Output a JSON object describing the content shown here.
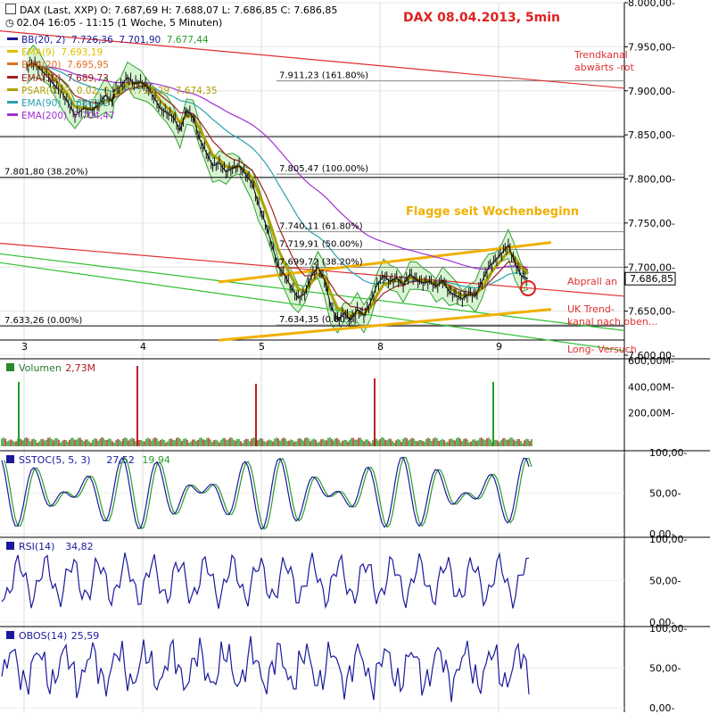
{
  "header": {
    "instrument": "DAX (Last, XXP)",
    "open": "O: 7.687,69",
    "high": "H: 7.688,07",
    "low": "L: 7.686,85",
    "close": "C: 7.686,85",
    "period": "02.04 16:05 - 11:15 (1 Woche, 5 Minuten)",
    "title": "DAX  08.04.2013,  5min"
  },
  "legend": [
    {
      "label": "BB(20, 2)",
      "values": [
        "7.726,36",
        "7.701,90",
        "7.677,44"
      ],
      "color": "#1a1a9c"
    },
    {
      "label": "EMA(9)",
      "values": [
        "7.693,19"
      ],
      "color": "#e0c000"
    },
    {
      "label": "EMA(20)",
      "values": [
        "7.695,95"
      ],
      "color": "#e07020"
    },
    {
      "label": "EMA(50)",
      "values": [
        "7.689,73"
      ],
      "color": "#a02020"
    },
    {
      "label": "PSAR(0.02, 0.02, 0.2)",
      "values": [
        "7.713,29",
        "7.674,35"
      ],
      "color": "#b0a000"
    },
    {
      "label": "EMA(90)",
      "values": [
        "7.686,62"
      ],
      "color": "#2aa0b0"
    },
    {
      "label": "EMA(200)",
      "values": [
        "7.704,47"
      ],
      "color": "#a030d0"
    }
  ],
  "annotations": {
    "trend_down": [
      "Trendkanal",
      "abwärts -rot"
    ],
    "flag": "Flagge seit Wochenbeginn",
    "bounce": "Abprall an",
    "uk_trend": [
      "UK Trend-",
      "kanal nach oben..."
    ],
    "long": "Long- Versuch"
  },
  "fib_labels": [
    {
      "text": "7.911,23 (161.80%)",
      "value": 7911.23
    },
    {
      "text": "7.801,80 (38.20%)",
      "value": 7801.8
    },
    {
      "text": "7.805,47 (100.00%)",
      "value": 7805.47
    },
    {
      "text": "7.740,11 (61.80%)",
      "value": 7740.11
    },
    {
      "text": "7.719,91 (50.00%)",
      "value": 7719.91
    },
    {
      "text": "7.699,72 (38.20%)",
      "value": 7699.72
    },
    {
      "text": "7.633,26 (0.00%)",
      "value": 7633.26
    },
    {
      "text": "7.634,35 (0.00%)",
      "value": 7634.35
    }
  ],
  "last_price_label": "7.686,85",
  "panels": {
    "volume": {
      "name": "Volumen",
      "value": "2,73M"
    },
    "sstoc": {
      "name": "SSTOC(5, 5, 3)",
      "value1": "27,52",
      "value2": "19,94"
    },
    "rsi": {
      "name": "RSI(14)",
      "value": "34,82"
    },
    "obos": {
      "name": "OBOS(14)",
      "value": "25,59"
    }
  },
  "chart_data": [
    {
      "type": "candlestick",
      "title": "DAX  08.04.2013,  5min",
      "x_ticks": [
        "3",
        "4",
        "5",
        "8",
        "9"
      ],
      "y_ticks": [
        "8.000,00",
        "7.950,00",
        "7.900,00",
        "7.850,00",
        "7.800,00",
        "7.750,00",
        "7.700,00",
        "7.650,00",
        "7.600,00"
      ],
      "ylim": [
        7600,
        8000
      ],
      "grid": true,
      "price_path": [
        [
          0,
          7928
        ],
        [
          0.3,
          7932
        ],
        [
          0.6,
          7925
        ],
        [
          1.0,
          7915
        ],
        [
          1.3,
          7905
        ],
        [
          1.6,
          7898
        ],
        [
          1.9,
          7886
        ],
        [
          2.2,
          7872
        ],
        [
          2.6,
          7880
        ],
        [
          3.0,
          7878
        ],
        [
          3.3,
          7885
        ],
        [
          3.6,
          7895
        ],
        [
          3.9,
          7888
        ],
        [
          4.0,
          7900
        ],
        [
          4.3,
          7905
        ],
        [
          4.6,
          7915
        ],
        [
          4.9,
          7908
        ],
        [
          5.2,
          7910
        ],
        [
          5.5,
          7905
        ],
        [
          5.8,
          7893
        ],
        [
          6.1,
          7880
        ],
        [
          6.4,
          7875
        ],
        [
          6.7,
          7870
        ],
        [
          7.0,
          7855
        ],
        [
          7.3,
          7878
        ],
        [
          7.6,
          7870
        ],
        [
          7.9,
          7845
        ],
        [
          8.2,
          7830
        ],
        [
          8.5,
          7815
        ],
        [
          8.8,
          7818
        ],
        [
          9.1,
          7808
        ],
        [
          9.4,
          7812
        ],
        [
          9.7,
          7815
        ],
        [
          10.0,
          7805
        ],
        [
          10.3,
          7795
        ],
        [
          10.6,
          7770
        ],
        [
          10.9,
          7750
        ],
        [
          11.2,
          7725
        ],
        [
          11.5,
          7700
        ],
        [
          11.8,
          7690
        ],
        [
          12.1,
          7676
        ],
        [
          12.4,
          7665
        ],
        [
          12.7,
          7670
        ],
        [
          13.0,
          7690
        ],
        [
          13.3,
          7700
        ],
        [
          13.6,
          7685
        ],
        [
          13.9,
          7655
        ],
        [
          14.2,
          7640
        ],
        [
          14.5,
          7648
        ],
        [
          14.8,
          7640
        ],
        [
          15.1,
          7652
        ],
        [
          15.4,
          7645
        ],
        [
          15.7,
          7660
        ],
        [
          16.0,
          7680
        ],
        [
          16.3,
          7690
        ],
        [
          16.6,
          7684
        ],
        [
          16.9,
          7688
        ],
        [
          17.2,
          7680
        ],
        [
          17.5,
          7692
        ],
        [
          17.8,
          7686
        ],
        [
          18.1,
          7682
        ],
        [
          18.4,
          7684
        ],
        [
          18.7,
          7678
        ],
        [
          19.0,
          7685
        ],
        [
          19.3,
          7672
        ],
        [
          19.6,
          7668
        ],
        [
          19.9,
          7664
        ],
        [
          20.2,
          7670
        ],
        [
          20.5,
          7668
        ],
        [
          20.8,
          7684
        ],
        [
          21.1,
          7700
        ],
        [
          21.4,
          7708
        ],
        [
          21.7,
          7716
        ],
        [
          22.0,
          7725
        ],
        [
          22.3,
          7705
        ],
        [
          22.6,
          7690
        ],
        [
          22.9,
          7686.85
        ]
      ]
    },
    {
      "type": "bar",
      "title": "Volumen",
      "y_ticks": [
        "200,00M",
        "400,00M",
        "600,00M"
      ],
      "ylim": [
        0,
        600
      ]
    },
    {
      "type": "line",
      "title": "SSTOC(5, 5, 3)",
      "y_ticks": [
        "0,00",
        "50,00",
        "100,00"
      ],
      "ylim": [
        0,
        100
      ],
      "last": [
        27.52,
        19.94
      ]
    },
    {
      "type": "line",
      "title": "RSI(14)",
      "y_ticks": [
        "0,00",
        "50,00",
        "100,00"
      ],
      "ylim": [
        0,
        100
      ],
      "last": [
        34.82
      ]
    },
    {
      "type": "line",
      "title": "OBOS(14)",
      "y_ticks": [
        "0,00",
        "50,00",
        "100,00"
      ],
      "ylim": [
        0,
        100
      ],
      "last": [
        25.59
      ]
    }
  ]
}
